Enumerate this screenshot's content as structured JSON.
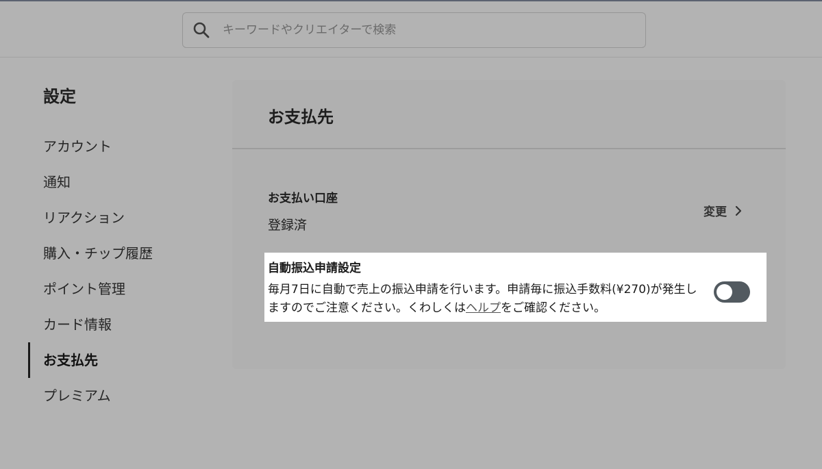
{
  "search": {
    "placeholder": "キーワードやクリエイターで検索",
    "icon": "search-icon"
  },
  "sidebar": {
    "title": "設定",
    "items": [
      {
        "label": "アカウント",
        "active": false
      },
      {
        "label": "通知",
        "active": false
      },
      {
        "label": "リアクション",
        "active": false
      },
      {
        "label": "購入・チップ履歴",
        "active": false
      },
      {
        "label": "ポイント管理",
        "active": false
      },
      {
        "label": "カード情報",
        "active": false
      },
      {
        "label": "お支払先",
        "active": true
      },
      {
        "label": "プレミアム",
        "active": false
      }
    ]
  },
  "main": {
    "title": "お支払先",
    "account": {
      "label": "お支払い口座",
      "value": "登録済",
      "change_label": "変更"
    },
    "auto_transfer": {
      "title": "自動振込申請設定",
      "desc_before": "毎月7日に自動で売上の振込申請を行います。申請毎に振込手数料(¥270)が発生しますのでご注意ください。くわしくは",
      "help_link": "ヘルプ",
      "desc_after": "をご確認ください。",
      "enabled": false
    }
  },
  "colors": {
    "background": "#b3b3b3",
    "highlight": "#ffffff",
    "toggle_off": "#525a60"
  }
}
